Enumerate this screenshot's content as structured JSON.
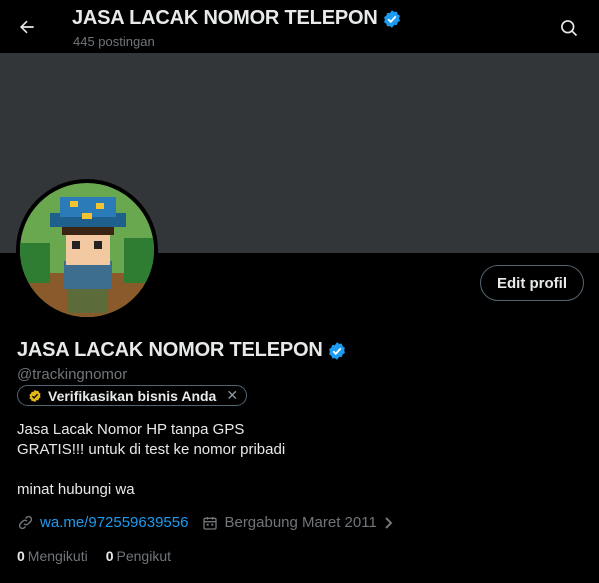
{
  "header": {
    "title": "JASA LACAK NOMOR TELEPON",
    "post_count": "445 postingan"
  },
  "profile": {
    "name": "JASA LACAK NOMOR TELEPON",
    "handle": "@trackingnomor",
    "edit_button": "Edit profil",
    "verify_chip": "Verifikasikan bisnis Anda",
    "bio": "Jasa Lacak Nomor HP tanpa GPS\nGRATIS!!! untuk di test ke nomor pribadi\n\nminat hubungi wa",
    "website": "wa.me/972559639556",
    "joined": "Bergabung Maret 2011",
    "following_count": "0",
    "following_label": "Mengikuti",
    "followers_count": "0",
    "followers_label": "Pengikut"
  },
  "colors": {
    "background": "#000000",
    "banner": "#333639",
    "accent": "#1d9bf0",
    "muted": "#71767b"
  },
  "icons": [
    "back-arrow-icon",
    "verified-badge-icon",
    "search-icon",
    "gold-check-icon",
    "close-icon",
    "link-icon",
    "calendar-icon",
    "chevron-right-icon"
  ]
}
